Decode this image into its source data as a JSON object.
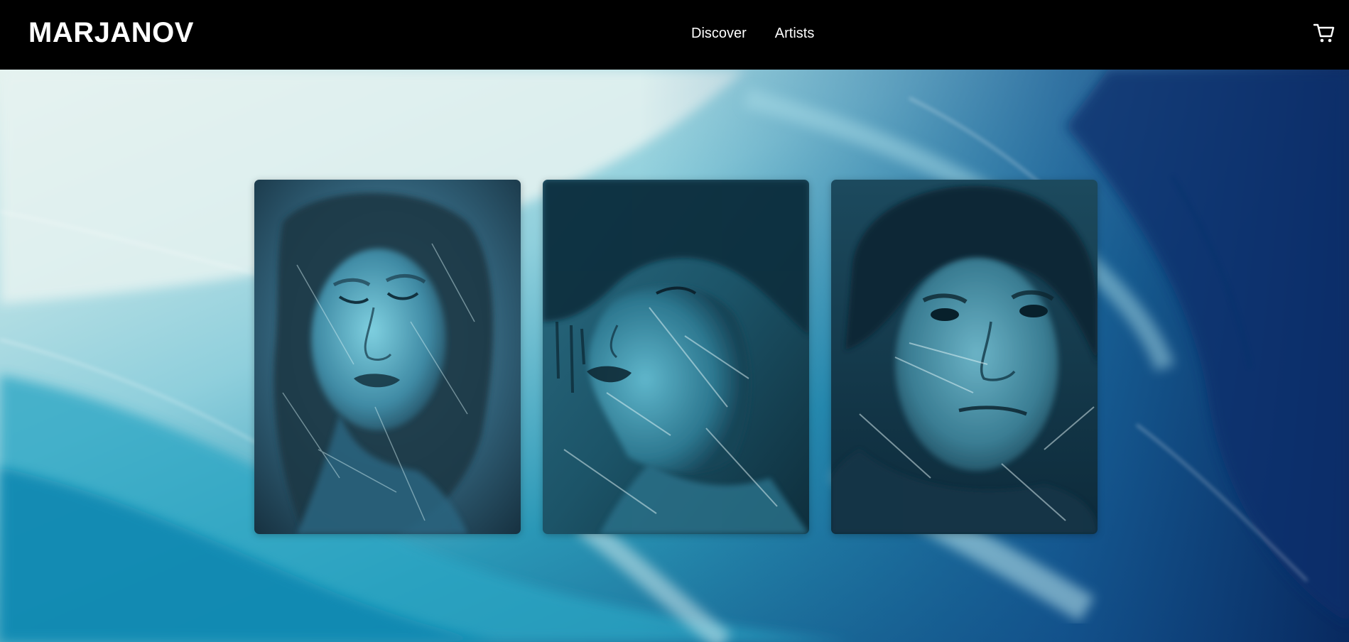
{
  "header": {
    "logo": "MARJANOV",
    "nav": [
      {
        "label": "Discover"
      },
      {
        "label": "Artists"
      }
    ],
    "cart_icon": "shopping-cart-icon"
  },
  "gallery": {
    "artworks": [
      {
        "description_icon": "portrait-woman-eyes-closed"
      },
      {
        "description_icon": "portrait-woman-profile"
      },
      {
        "description_icon": "portrait-man-face"
      }
    ]
  },
  "colors": {
    "header_bg": "#000000",
    "header_text": "#ffffff",
    "hero_light": "#d8eef0",
    "hero_mid": "#2a98b8",
    "hero_dark": "#0a3a72"
  }
}
